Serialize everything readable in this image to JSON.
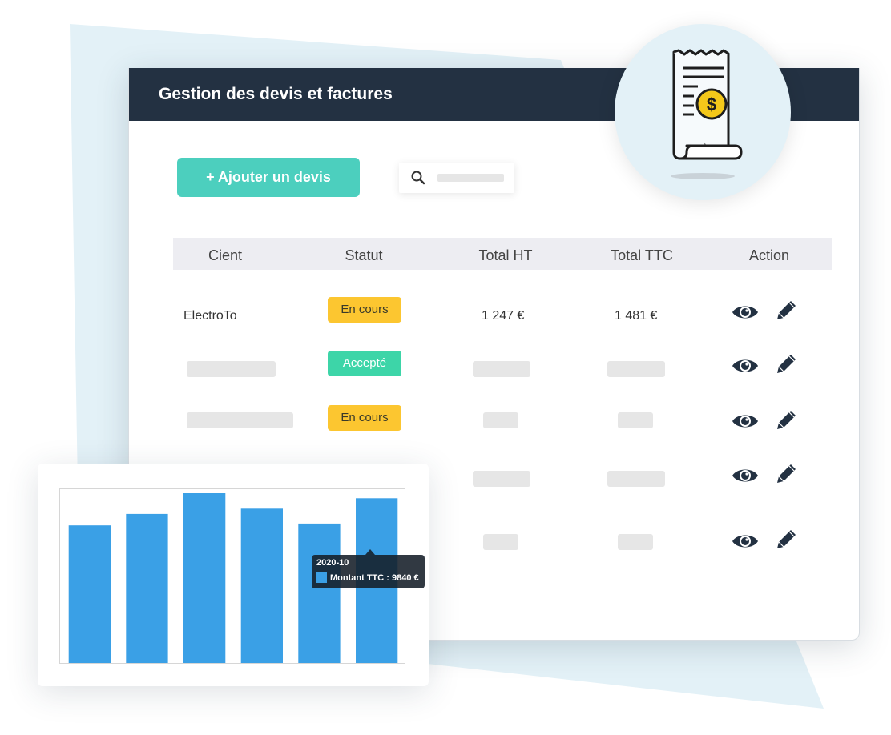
{
  "window": {
    "title": "Gestion des devis et factures"
  },
  "toolbar": {
    "add_label": "+ Ajouter un devis",
    "search_icon": "search-icon",
    "search_placeholder": ""
  },
  "table": {
    "columns": [
      "Cient",
      "Statut",
      "Total HT",
      "Total TTC",
      "Action"
    ],
    "rows": [
      {
        "client": "ElectroTo",
        "status": "En cours",
        "status_type": "en-cours",
        "total_ht": "1 247 €",
        "total_ttc": "1 481 €"
      },
      {
        "client": "",
        "status": "Accepté",
        "status_type": "accepte",
        "total_ht": "",
        "total_ttc": ""
      },
      {
        "client": "",
        "status": "En cours",
        "status_type": "en-cours",
        "total_ht": "",
        "total_ttc": ""
      },
      {
        "client": "",
        "status": "",
        "status_type": "",
        "total_ht": "",
        "total_ttc": ""
      },
      {
        "client": "",
        "status": "",
        "status_type": "",
        "total_ht": "",
        "total_ttc": ""
      }
    ],
    "actions": [
      "view-icon",
      "edit-icon"
    ]
  },
  "colors": {
    "titlebar": "#233142",
    "accent": "#4ccfbe",
    "status_en_cours": "#fcc630",
    "status_accepte": "#3dd5a8",
    "bar": "#3aa0e6",
    "background_shape": "#e3f1f7"
  },
  "decoration": {
    "illustration": "receipt-dollar-icon"
  },
  "chart_data": {
    "type": "bar",
    "title": "",
    "xlabel": "",
    "ylabel": "",
    "categories": [
      "",
      "",
      "",
      "",
      "",
      "2020-10"
    ],
    "series": [
      {
        "name": "Montant TTC",
        "values": [
          8220,
          8900,
          10140,
          9220,
          8330,
          9840
        ]
      }
    ],
    "ylim": [
      0,
      10380
    ],
    "grid": false,
    "legend": "none",
    "tooltip": {
      "category": "2020-10",
      "label": "Montant TTC : 9840 €"
    }
  }
}
